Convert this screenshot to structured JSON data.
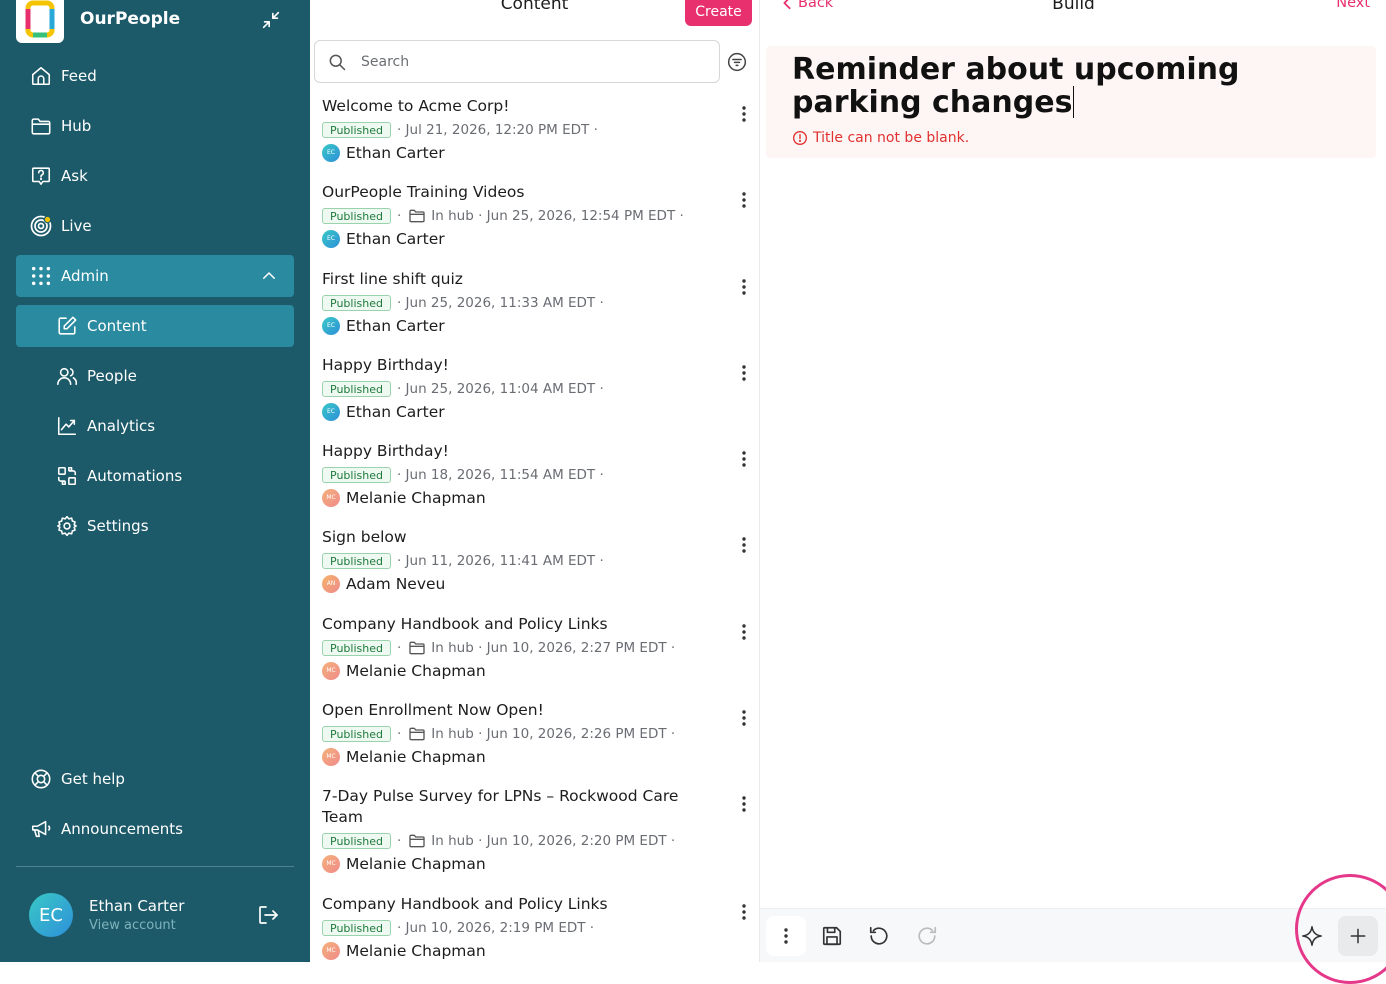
{
  "app": {
    "name": "OurPeople"
  },
  "sidebar": {
    "items": [
      {
        "label": "Feed",
        "icon": "home-icon"
      },
      {
        "label": "Hub",
        "icon": "folder-icon"
      },
      {
        "label": "Ask",
        "icon": "question-icon"
      },
      {
        "label": "Live",
        "icon": "live-icon"
      },
      {
        "label": "Admin",
        "icon": "grid-icon",
        "expanded": true
      }
    ],
    "admin_items": [
      {
        "label": "Content",
        "icon": "edit-icon",
        "active": true
      },
      {
        "label": "People",
        "icon": "people-icon"
      },
      {
        "label": "Analytics",
        "icon": "chart-icon"
      },
      {
        "label": "Automations",
        "icon": "automations-icon"
      },
      {
        "label": "Settings",
        "icon": "gear-icon"
      }
    ],
    "bottom_items": [
      {
        "label": "Get help",
        "icon": "lifebuoy-icon"
      },
      {
        "label": "Announcements",
        "icon": "megaphone-icon"
      }
    ],
    "account": {
      "initials": "EC",
      "name": "Ethan Carter",
      "link": "View account"
    }
  },
  "content": {
    "title": "Content",
    "create_label": "Create",
    "search_placeholder": "Search",
    "items": [
      {
        "title": "Welcome to Acme Corp!",
        "status": "Published",
        "meta": "· Jul 21, 2026, 12:20 PM EDT ·",
        "author": "Ethan Carter",
        "initials": "EC"
      },
      {
        "title": "OurPeople Training Videos",
        "status": "Published",
        "hub": "In hub",
        "meta": "· Jun 25, 2026, 12:54 PM EDT ·",
        "author": "Ethan Carter",
        "initials": "EC"
      },
      {
        "title": "First line shift quiz",
        "status": "Published",
        "meta": "· Jun 25, 2026, 11:33 AM EDT ·",
        "author": "Ethan Carter",
        "initials": "EC"
      },
      {
        "title": "Happy Birthday!",
        "status": "Published",
        "meta": "· Jun 25, 2026, 11:04 AM EDT ·",
        "author": "Ethan Carter",
        "initials": "EC"
      },
      {
        "title": "Happy Birthday!",
        "status": "Published",
        "meta": "· Jun 18, 2026, 11:54 AM EDT ·",
        "author": "Melanie Chapman",
        "initials": "MC"
      },
      {
        "title": "Sign below",
        "status": "Published",
        "meta": "· Jun 11, 2026, 11:41 AM EDT ·",
        "author": "Adam Neveu",
        "initials": "AN"
      },
      {
        "title": "Company Handbook and Policy Links",
        "status": "Published",
        "hub": "In hub",
        "meta": "· Jun 10, 2026, 2:27 PM EDT ·",
        "author": "Melanie Chapman",
        "initials": "MC"
      },
      {
        "title": "Open Enrollment Now Open!",
        "status": "Published",
        "hub": "In hub",
        "meta": "· Jun 10, 2026, 2:26 PM EDT ·",
        "author": "Melanie Chapman",
        "initials": "MC"
      },
      {
        "title": "7-Day Pulse Survey for LPNs – Rockwood Care Team",
        "status": "Published",
        "hub": "In hub",
        "meta": "· Jun 10, 2026, 2:20 PM EDT ·",
        "author": "Melanie Chapman",
        "initials": "MC"
      },
      {
        "title": "Company Handbook and Policy Links",
        "status": "Published",
        "meta": "· Jun 10, 2026, 2:19 PM EDT ·",
        "author": "Melanie Chapman",
        "initials": "MC"
      }
    ]
  },
  "build": {
    "back_label": "Back",
    "title": "Build",
    "next_label": "Next",
    "post_title": "Reminder about upcoming parking changes",
    "error": "Title can not be blank."
  },
  "colors": {
    "sidebar": "#1c5a69",
    "active": "#2a8aa0",
    "accent": "#e8306f",
    "error": "#e03131"
  }
}
